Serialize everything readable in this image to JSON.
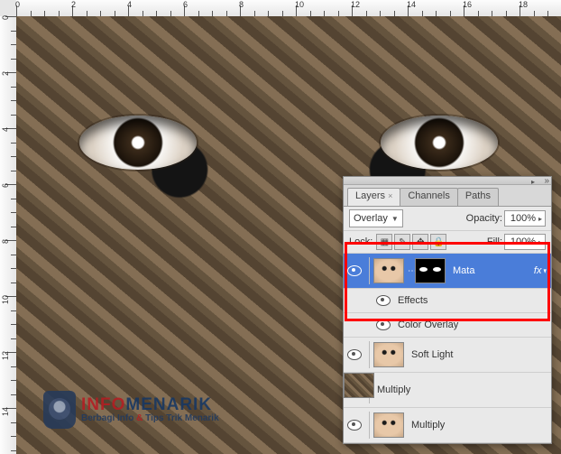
{
  "ruler": {
    "h": [
      0,
      2,
      4,
      6,
      8,
      10,
      12,
      14,
      16,
      18
    ],
    "v": [
      0,
      2,
      4,
      6,
      8,
      10,
      12,
      14
    ]
  },
  "watermark": {
    "title1": "INFO",
    "title2": "MENARIK",
    "sub_a": "Berbagi Info ",
    "sub_amp": "&",
    "sub_b": " Tips Trik Menarik"
  },
  "panel": {
    "tabs": {
      "layers": "Layers",
      "channels": "Channels",
      "paths": "Paths"
    },
    "blend_mode": "Overlay",
    "opacity_label": "Opacity:",
    "opacity_value": "100%",
    "lock_label": "Lock:",
    "fill_label": "Fill:",
    "fill_value": "100%",
    "layers": [
      {
        "name": "Mata",
        "fx": "fx"
      },
      {
        "name": "Effects"
      },
      {
        "name": "Color Overlay"
      },
      {
        "name": "Soft Light"
      },
      {
        "name": "Multiply"
      },
      {
        "name": "Multiply"
      }
    ]
  }
}
